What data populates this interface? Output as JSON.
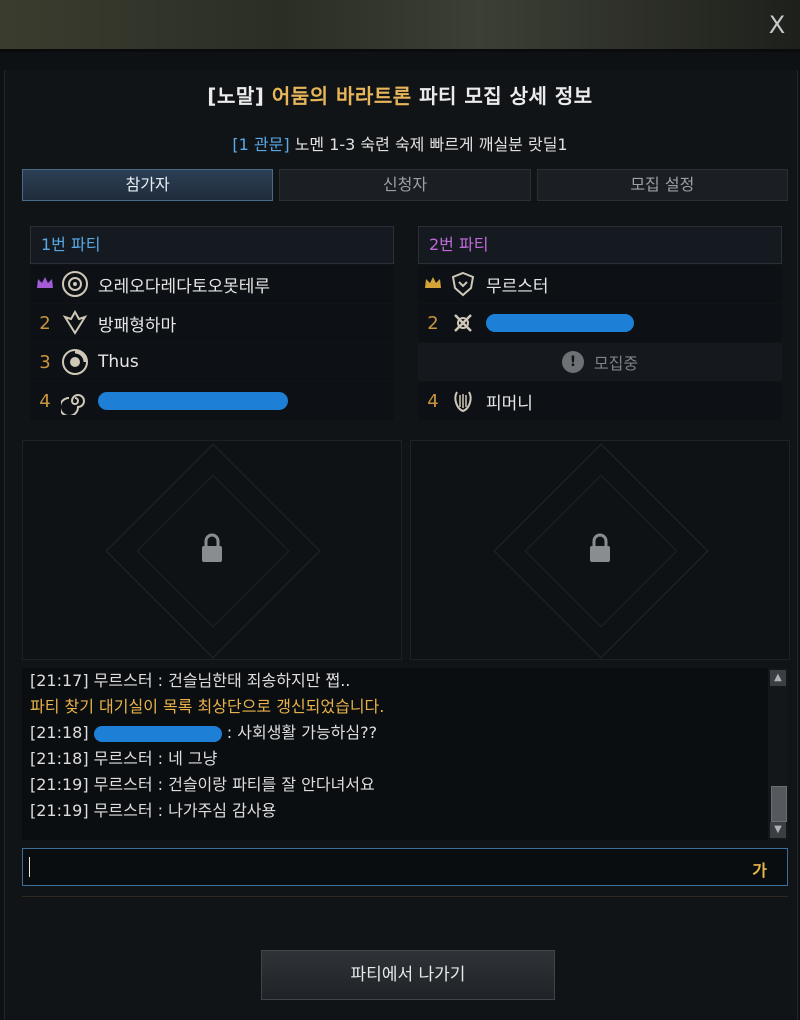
{
  "window": {
    "close_label": "X"
  },
  "header": {
    "title_prefix": "[노말]",
    "title_highlight": "어둠의 바라트론",
    "title_suffix": "파티 모집 상세 정보",
    "subtitle_tag": "[1 관문]",
    "subtitle_text": "노멘 1-3 숙련 숙제 빠르게 깨실분 랏딜1"
  },
  "tabs": [
    "참가자",
    "신청자",
    "모집 설정"
  ],
  "party1": {
    "title": "1번 파티",
    "title_color": "#5aa8e6",
    "members": [
      {
        "slot": "crown",
        "crown_color": "#a35bd6",
        "name": "오레오다레다토오못테루",
        "icon": "emblem-wheel-icon"
      },
      {
        "slot": "2",
        "name": "방패형하마",
        "icon": "emblem-wings-icon"
      },
      {
        "slot": "3",
        "name": "Thus",
        "icon": "emblem-wheel-icon"
      },
      {
        "slot": "4",
        "name": "",
        "icon": "emblem-spiral-icon",
        "redacted": true
      }
    ]
  },
  "party2": {
    "title": "2번 파티",
    "title_color": "#c06ad8",
    "members": [
      {
        "slot": "crown",
        "crown_color": "#d4a43a",
        "name": "무르스터",
        "icon": "emblem-shield-icon"
      },
      {
        "slot": "2",
        "name": "",
        "icon": "emblem-cross-icon",
        "redacted": true
      },
      {
        "slot": "",
        "recruit": true,
        "name": "모집중",
        "icon": "exclamation-icon"
      },
      {
        "slot": "4",
        "name": "피머니",
        "icon": "emblem-lyre-icon"
      }
    ]
  },
  "chat": {
    "lines": [
      {
        "text": "[21:17] 무르스터 : 건슬님한태 죄송하지만 쩝..",
        "system": false
      },
      {
        "text": "파티 찾기 대기실이 목록 최상단으로 갱신되었습니다.",
        "system": true
      },
      {
        "prefix": "[21:18]",
        "text": ": 사회생활 가능하심??",
        "system": false,
        "redacted": true
      },
      {
        "text": "[21:18] 무르스터 : 네 그냥",
        "system": false
      },
      {
        "text": "[21:19] 무르스터 : 건슬이랑 파티를 잘 안다녀서요",
        "system": false
      },
      {
        "text": "[21:19] 무르스터 : 나가주심 감사용",
        "system": false
      }
    ],
    "input_value": "",
    "ime_indicator": "가"
  },
  "footer": {
    "leave_label": "파티에서 나가기"
  },
  "colors": {
    "gold": "#e8b65a",
    "system_text": "#e8b14a",
    "redaction": "#1e7fd6"
  }
}
